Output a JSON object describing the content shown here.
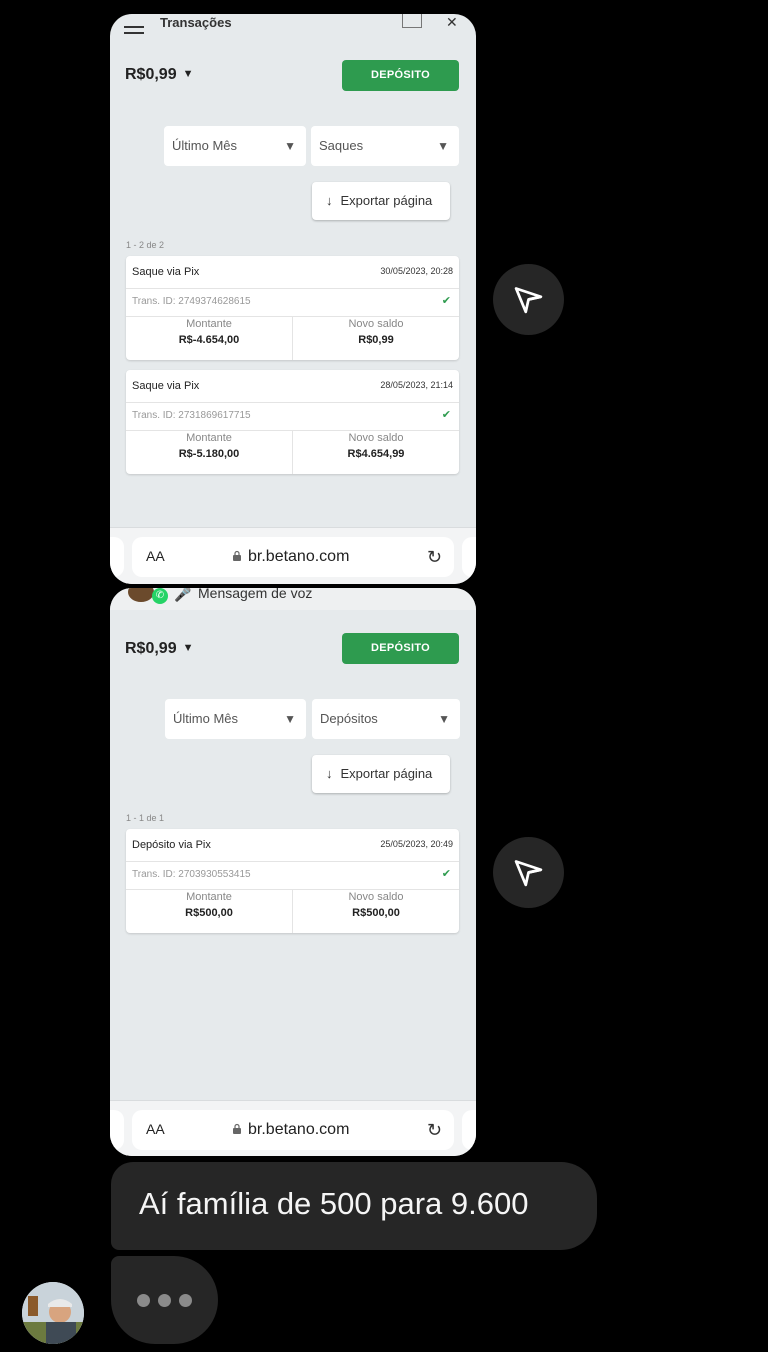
{
  "screenshot1": {
    "top_title": "Transações",
    "balance": "R$0,99",
    "deposit_label": "DEPÓSITO",
    "filter_period": "Último Mês",
    "filter_type": "Saques",
    "export_label": "Exportar página",
    "count": "1 - 2 de 2",
    "transactions": [
      {
        "title": "Saque via Pix",
        "date": "30/05/2023, 20:28",
        "trans_id": "Trans. ID: 2749374628615",
        "amount_label": "Montante",
        "amount": "R$-4.654,00",
        "balance_label": "Novo saldo",
        "balance": "R$0,99"
      },
      {
        "title": "Saque via Pix",
        "date": "28/05/2023, 21:14",
        "trans_id": "Trans. ID: 2731869617715",
        "amount_label": "Montante",
        "amount": "R$-5.180,00",
        "balance_label": "Novo saldo",
        "balance": "R$4.654,99"
      }
    ],
    "browser": {
      "aa": "AA",
      "url": "br.betano.com"
    }
  },
  "screenshot2": {
    "voice_message": "Mensagem de voz",
    "balance": "R$0,99",
    "deposit_label": "DEPÓSITO",
    "filter_period": "Último Mês",
    "filter_type": "Depósitos",
    "export_label": "Exportar página",
    "count": "1 - 1 de 1",
    "transactions": [
      {
        "title": "Depósito via Pix",
        "date": "25/05/2023, 20:49",
        "trans_id": "Trans. ID: 2703930553415",
        "amount_label": "Montante",
        "amount": "R$500,00",
        "balance_label": "Novo saldo",
        "balance": "R$500,00"
      }
    ],
    "browser": {
      "aa": "AA",
      "url": "br.betano.com"
    }
  },
  "message": {
    "text": "Aí família de 500 para 9.600"
  },
  "icons": {
    "send": "send-icon",
    "typing": "typing-indicator"
  },
  "colors": {
    "accent_green": "#2e9b4f",
    "bubble": "#262626",
    "background": "#000000"
  }
}
